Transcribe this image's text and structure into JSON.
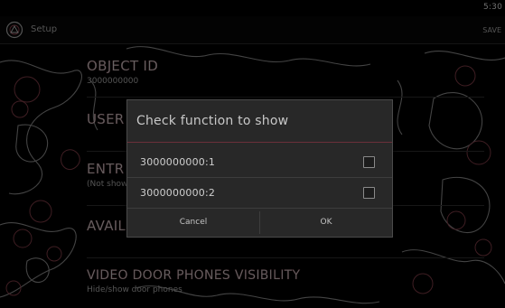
{
  "status_bar": {
    "time": "5:30"
  },
  "action_bar": {
    "title": "Setup",
    "right_text": "SAVE",
    "icon": "app-logo-icon"
  },
  "settings": [
    {
      "title": "OBJECT ID",
      "summary": "3000000000"
    },
    {
      "title": "USER",
      "summary": ""
    },
    {
      "title": "ENTR",
      "summary": "(Not shown)"
    },
    {
      "title": "AVAIL",
      "summary": ""
    },
    {
      "title": "VIDEO DOOR PHONES VISIBILITY",
      "summary": "Hide/show door phones"
    }
  ],
  "dialog": {
    "title": "Check function to show",
    "items": [
      {
        "label": "3000000000:1",
        "checked": false
      },
      {
        "label": "3000000000:2",
        "checked": false
      }
    ],
    "cancel_label": "Cancel",
    "ok_label": "OK"
  },
  "colors": {
    "background": "#000000",
    "dialog_bg": "#282828",
    "accent_outline": "#7a3a44"
  }
}
